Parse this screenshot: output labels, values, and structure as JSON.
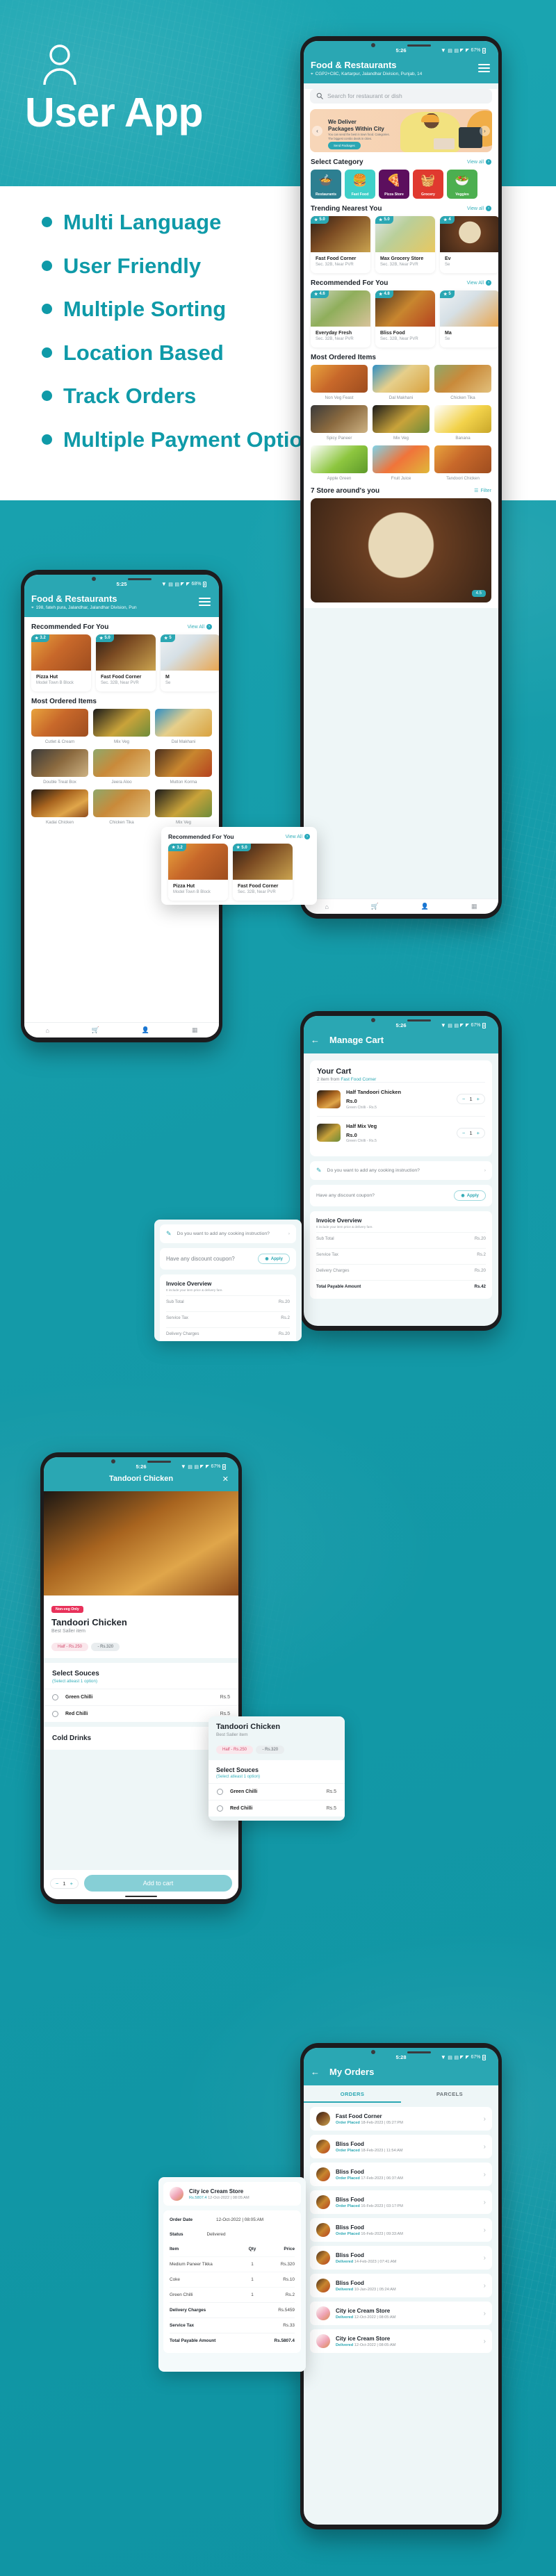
{
  "hero": {
    "title": "User App",
    "icon": "user-avatar-icon"
  },
  "features": [
    "Multi Language",
    "User Friendly",
    "Multiple Sorting",
    "Location Based",
    "Track Orders",
    "Multiple Payment Options"
  ],
  "colors": {
    "brand": "#2aa7b3",
    "background": "#1aa3b0",
    "accent": "#37b0bb",
    "nonveg": "#e8315a"
  },
  "home_main": {
    "status": {
      "time": "5:26",
      "battery": "67%"
    },
    "title": "Food & Restaurants",
    "address": "CGP2+C8C, Kartarpur, Jalandhar Division, Punjab, 14",
    "search_placeholder": "Search for restaurant or dish",
    "banner": {
      "title_line1": "We Deliver",
      "title_line2": "Packages Within City",
      "subtitle": "You can send the best in town food. Categories. The biggest combo deals in cities.",
      "cta": "Send Packages"
    },
    "select_category": {
      "title": "Select Category",
      "view_all": "View all"
    },
    "categories": [
      {
        "label": "Restaurants",
        "emoji": "🍲",
        "color": "#2d7f91"
      },
      {
        "label": "Fast Food",
        "emoji": "🍔",
        "color": "#3fd0c9"
      },
      {
        "label": "Pizza Store",
        "emoji": "🍕",
        "color": "#5c0f5e"
      },
      {
        "label": "Grocery",
        "emoji": "🧺",
        "color": "#e0392f"
      },
      {
        "label": "Veggies",
        "emoji": "🥗",
        "color": "#4caf50"
      }
    ],
    "trending": {
      "title": "Trending Nearest You",
      "view_all": "View all"
    },
    "trending_items": [
      {
        "name": "Fast Food Corner",
        "address": "Sec. 32B, Near PVR",
        "rating": "5.0",
        "img": "f-burger"
      },
      {
        "name": "Max Grocery Store",
        "address": "Sec. 32B, Near PVR",
        "rating": "5.0",
        "img": "f-grocery"
      },
      {
        "name": "Ev",
        "address": "Se",
        "rating": "4",
        "img": "f-plate"
      }
    ],
    "recommended": {
      "title": "Recommended For You",
      "view_all": "View All"
    },
    "recommended_items": [
      {
        "name": "Everyday Fresh",
        "address": "Sec. 32B, Near PVR",
        "rating": "4.6",
        "img": "f-salad"
      },
      {
        "name": "Bliss Food",
        "address": "Sec. 32B, Near PVR",
        "rating": "4.8",
        "img": "f-thali"
      },
      {
        "name": "Ma",
        "address": "Se",
        "rating": "5",
        "img": "f-milk"
      }
    ],
    "most_ordered": {
      "title": "Most Ordered Items"
    },
    "most_ordered_items": [
      {
        "label": "Non Veg Feast",
        "img": "f-pizza"
      },
      {
        "label": "Dal Makhani",
        "img": "f-dal"
      },
      {
        "label": "Chicken Tika",
        "img": "f-tikka"
      },
      {
        "label": "Spicy Paneer",
        "img": "f-paneer"
      },
      {
        "label": "Mix Veg",
        "img": "f-mixveg"
      },
      {
        "label": "Banana",
        "img": "f-banana"
      },
      {
        "label": "Apple Green",
        "img": "f-apple"
      },
      {
        "label": "Fruit Juice",
        "img": "f-juice"
      },
      {
        "label": "Tandoori Chicken",
        "img": "f-pizza"
      }
    ],
    "stores": {
      "title": "7 Store around's you",
      "filter": "Filter",
      "rating_badge": "4.5"
    }
  },
  "home_secondary": {
    "status": {
      "time": "5:25",
      "battery": "68%"
    },
    "title": "Food & Restaurants",
    "address": "198, fateh pura, Jalandhar, Jalandhar Division, Pun",
    "recommended": {
      "title": "Recommended For You",
      "view_all": "View All"
    },
    "recommended_items": [
      {
        "name": "Pizza Hut",
        "address": "Model Town B Block",
        "rating": "3.2",
        "img": "f-pizza"
      },
      {
        "name": "Fast Food Corner",
        "address": "Sec. 32B, Near PVR",
        "rating": "5.0",
        "img": "f-burger"
      },
      {
        "name": "M",
        "address": "Se",
        "rating": "5",
        "img": "f-milk"
      }
    ],
    "most_ordered": {
      "title": "Most Ordered Items"
    },
    "most_ordered_items": [
      {
        "label": "Cutlet & Cream",
        "img": "f-pizza"
      },
      {
        "label": "Mix Veg",
        "img": "f-mixveg"
      },
      {
        "label": "Dal Makhani",
        "img": "f-dal"
      },
      {
        "label": "Double Treat Box",
        "img": "f-paneer"
      },
      {
        "label": "Jeera Aloo",
        "img": "f-tikka"
      },
      {
        "label": "Mutton Korma",
        "img": "f-thali"
      },
      {
        "label": "Kadai Chicken",
        "img": "f-chicken"
      },
      {
        "label": "Chicken Tika",
        "img": "f-tikka"
      },
      {
        "label": "Mix Veg",
        "img": "f-mixveg"
      }
    ]
  },
  "home_popup": {
    "title": "Recommended For You",
    "view_all": "View All",
    "items": [
      {
        "name": "Pizza Hut",
        "address": "Model Town B Block",
        "rating": "3.2",
        "img": "f-pizza"
      },
      {
        "name": "Fast Food Corner",
        "address": "Sec. 32B, Near PVR",
        "rating": "5.0",
        "img": "f-burger"
      }
    ]
  },
  "cart": {
    "status": {
      "time": "5:26",
      "battery": "67%"
    },
    "title": "Manage Cart",
    "back_icon": "back-arrow-icon",
    "heading": "Your Cart",
    "subheading_prefix": "2 item from ",
    "restaurant": "Fast Food Corner",
    "items": [
      {
        "name": "Half Tandoori Chicken",
        "price": "Rs.0",
        "extra": "Green Chilli - Rs.5",
        "qty": "1",
        "img": "f-chicken"
      },
      {
        "name": "Half Mix Veg",
        "price": "Rs.0",
        "extra": "Green Chilli - Rs.5",
        "qty": "1",
        "img": "f-mixveg"
      }
    ],
    "cooking_instruction": "Do you want to add any cooking instruction?",
    "coupon_placeholder": "Have any discount coupon?",
    "apply": "Apply",
    "invoice": {
      "title": "Invoice Overview",
      "note": "It include your item price & delivery fare.",
      "rows": [
        {
          "label": "Sub Total",
          "value": "Rs.20"
        },
        {
          "label": "Service Tax",
          "value": "Rs.2"
        },
        {
          "label": "Delivery Charges",
          "value": "Rs.20"
        }
      ],
      "total_label": "Total Payable Amount",
      "total_value": "Rs.42"
    }
  },
  "product": {
    "status": {
      "time": "5:26",
      "battery": "67%"
    },
    "title": "Tandoori Chicken",
    "close_icon": "close-icon",
    "tag": "Non-veg Only",
    "name": "Tandoori Chicken",
    "subtitle": "Best Saller item",
    "price_half": "Half - Rs.250",
    "price_full": "- Rs.320",
    "sauces": {
      "title": "Select Souces",
      "hint": "(Select atleast 1 option)",
      "options": [
        {
          "label": "Green Chilli",
          "price": "Rs.5"
        },
        {
          "label": "Red Chilli",
          "price": "Rs.5"
        }
      ]
    },
    "cold_drinks": "Cold Drinks",
    "qty": "1",
    "add_to_cart": "Add to cart"
  },
  "orders": {
    "status": {
      "time": "5:28",
      "battery": "67%"
    },
    "title": "My Orders",
    "tabs": [
      {
        "label": "ORDERS",
        "active": true
      },
      {
        "label": "PARCELS",
        "active": false
      }
    ],
    "list": [
      {
        "name": "Fast Food Corner",
        "status": "Order Placed",
        "date": "18-Feb-2023 | 05:27:PM",
        "img": "f-burger"
      },
      {
        "name": "Bliss Food",
        "status": "Order Placed",
        "date": "18-Feb-2023 | 11:54:AM",
        "img": "f-thali"
      },
      {
        "name": "Bliss Food",
        "status": "Order Placed",
        "date": "17-Feb-2023 | 06:37:AM",
        "img": "f-thali"
      },
      {
        "name": "Bliss Food",
        "status": "Order Placed",
        "date": "16-Feb-2023 | 03:17:PM",
        "img": "f-thali"
      },
      {
        "name": "Bliss Food",
        "status": "Order Placed",
        "date": "16-Feb-2023 | 09:33:AM",
        "img": "f-thali"
      },
      {
        "name": "Bliss Food",
        "status": "Delivered",
        "date": "14-Feb-2023 | 07:41:AM",
        "img": "f-thali"
      },
      {
        "name": "Bliss Food",
        "status": "Delivered",
        "date": "10-Jan-2023 | 05:24:AM",
        "img": "f-thali"
      },
      {
        "name": "City ice Cream Store",
        "status": "Delivered",
        "date": "12-Oct-2022 | 08:05:AM",
        "img": "f-ice"
      },
      {
        "name": "City ice Cream Store",
        "status": "Delivered",
        "date": "12-Oct-2022 | 08:05:AM",
        "img": "f-ice"
      }
    ]
  },
  "order_detail": {
    "store": "City ice Cream Store",
    "amount": "Rs.5807.4",
    "stamp": "12-Oct-2022 | 08:05:AM",
    "order_date_label": "Order Date",
    "order_date_value": "12-Oct-2022 | 08:05:AM",
    "status_label": "Status",
    "status_value": "Delivered",
    "columns": {
      "item": "Item",
      "qty": "Qty",
      "price": "Price"
    },
    "items": [
      {
        "name": "Medium Paneer Tikka",
        "qty": "1",
        "price": "Rs.320"
      },
      {
        "name": "Coke",
        "qty": "1",
        "price": "Rs.10"
      },
      {
        "name": "Green Chilli",
        "qty": "1",
        "price": "Rs.2"
      }
    ],
    "summary": [
      {
        "label": "Delivery Charges",
        "value": "Rs.5459"
      },
      {
        "label": "Service Tax",
        "value": "Rs.33"
      }
    ],
    "total_label": "Total Payable Amount",
    "total_value": "Rs.5807.4"
  }
}
